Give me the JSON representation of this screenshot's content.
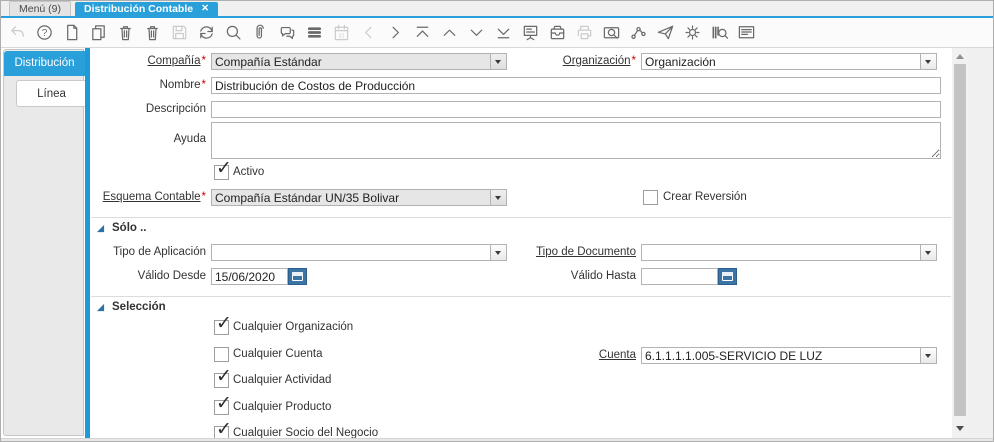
{
  "ui": {
    "required_marker": "*",
    "close_icon": "✕",
    "check_icon": "✓"
  },
  "colors": {
    "accent_blue": "#2aa0da",
    "sidebar_bar_blue": "#1d9bd7",
    "calendar_button_blue": "#3a75a6",
    "section_triangle_blue": "#2a72a8",
    "required_red": "#cc0000"
  },
  "window": {
    "tabs": [
      {
        "label": "Menú (9)",
        "active": false,
        "closable": false
      },
      {
        "label": "Distribución Contable",
        "active": true,
        "closable": true
      }
    ]
  },
  "toolbar": {
    "items": [
      {
        "name": "undo-icon",
        "disabled": true
      },
      {
        "name": "help-icon",
        "disabled": false
      },
      {
        "name": "new-record-icon",
        "disabled": false
      },
      {
        "name": "copy-record-icon",
        "disabled": false
      },
      {
        "name": "delete-record-icon",
        "disabled": false
      },
      {
        "name": "delete-selection-icon",
        "disabled": false
      },
      {
        "name": "save-icon",
        "disabled": true
      },
      {
        "name": "refresh-icon",
        "disabled": false
      },
      {
        "name": "find-record-icon",
        "disabled": false
      },
      {
        "name": "attachment-icon",
        "disabled": false
      },
      {
        "name": "chat-icon",
        "disabled": false
      },
      {
        "name": "grid-toggle-icon",
        "disabled": false
      },
      {
        "name": "calendar-icon",
        "disabled": true
      },
      {
        "name": "parent-record-icon",
        "disabled": true
      },
      {
        "name": "detail-record-icon",
        "disabled": false
      },
      {
        "name": "first-record-icon",
        "disabled": false
      },
      {
        "name": "previous-record-icon",
        "disabled": false
      },
      {
        "name": "next-record-icon",
        "disabled": false
      },
      {
        "name": "last-record-icon",
        "disabled": false
      },
      {
        "name": "report-icon",
        "disabled": false
      },
      {
        "name": "archive-icon",
        "disabled": false
      },
      {
        "name": "print-icon",
        "disabled": true
      },
      {
        "name": "screenshot-icon",
        "disabled": false
      },
      {
        "name": "workflow-icon",
        "disabled": false
      },
      {
        "name": "send-mail-icon",
        "disabled": false
      },
      {
        "name": "preference-icon",
        "disabled": false
      },
      {
        "name": "product-info-icon",
        "disabled": false
      },
      {
        "name": "window-help-icon",
        "disabled": false
      }
    ]
  },
  "sidebar": {
    "tabs": [
      {
        "label": "Distribución",
        "active": true
      },
      {
        "label": "Línea",
        "active": false
      }
    ]
  },
  "form": {
    "compania": {
      "label": "Compañía",
      "value": "Compañía Estándar"
    },
    "organizacion": {
      "label": "Organización",
      "value": "Organización"
    },
    "nombre": {
      "label": "Nombre",
      "value": "Distribución de Costos de Producción"
    },
    "descripcion": {
      "label": "Descripción",
      "value": ""
    },
    "ayuda": {
      "label": "Ayuda",
      "value": ""
    },
    "activo": {
      "label": "Activo",
      "checked": true
    },
    "esquema_contable": {
      "label": "Esquema Contable",
      "value": "Compañía Estándar UN/35 Bolivar"
    },
    "crear_reversion": {
      "label": "Crear Reversión",
      "checked": false
    }
  },
  "solo_section": {
    "title": "Sólo ..",
    "tipo_aplicacion": {
      "label": "Tipo de Aplicación",
      "value": ""
    },
    "tipo_documento": {
      "label": "Tipo de Documento",
      "value": ""
    },
    "valido_desde": {
      "label": "Válido Desde",
      "value": "15/06/2020"
    },
    "valido_hasta": {
      "label": "Válido Hasta",
      "value": ""
    }
  },
  "seleccion_section": {
    "title": "Selección",
    "checkboxes": [
      {
        "label": "Cualquier Organización",
        "checked": true
      },
      {
        "label": "Cualquier Cuenta",
        "checked": false
      },
      {
        "label": "Cualquier Actividad",
        "checked": true
      },
      {
        "label": "Cualquier Producto",
        "checked": true
      },
      {
        "label": "Cualquier Socio del Negocio",
        "checked": true
      }
    ],
    "cuenta": {
      "label": "Cuenta",
      "value": "6.1.1.1.1.005-SERVICIO DE LUZ"
    }
  }
}
